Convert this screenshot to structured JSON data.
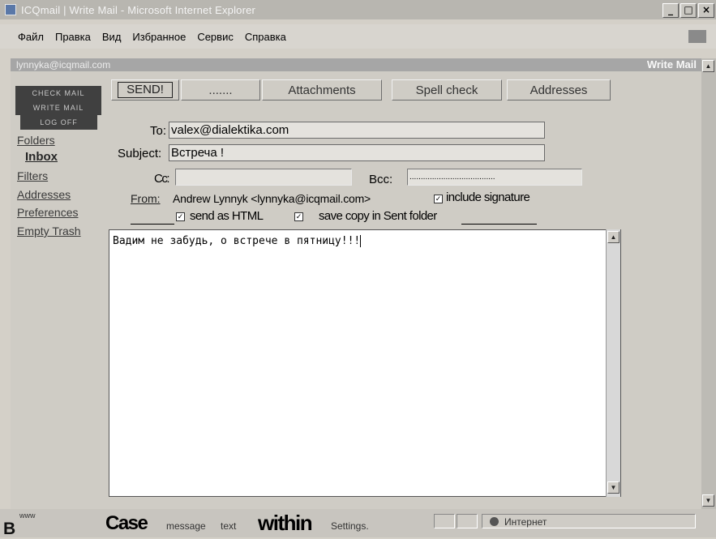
{
  "window": {
    "title": "ICQmail | Write Mail - Microsoft Internet Explorer",
    "controls": [
      "_",
      "□",
      "×"
    ]
  },
  "menu": [
    "Файл",
    "Правка",
    "Вид",
    "Избранное",
    "Сервис",
    "Справка"
  ],
  "banner": {
    "account": "lynnyka@icqmail.com",
    "page_title": "Write Mail"
  },
  "nav_buttons": [
    "Check Mail",
    "Write Mail",
    "Log Off"
  ],
  "sidebar_links": [
    "Folders",
    "Inbox",
    "Filters",
    "Addresses",
    "Preferences",
    "Empty Trash"
  ],
  "toolbar": {
    "send": "SEND!",
    "dots": ".......",
    "attachments": "Attachments",
    "spell_check": "Spell check",
    "addresses": "Addresses"
  },
  "compose": {
    "to_label": "To:",
    "to_value": "valex@dialektika.com",
    "subject_label": "Subject:",
    "subject_value": "Встреча !",
    "cc_label": "Cc:",
    "cc_value": "",
    "bcc_label": "Bcc:",
    "bcc_value": "......................................",
    "from_label": "From:",
    "from_value": "Andrew Lynnyk <lynnyka@icqmail.com>",
    "include_signature": "include signature",
    "send_as_html": "send as HTML",
    "save_copy": "save copy in Sent folder",
    "include_signature_checked": true,
    "send_as_html_checked": true,
    "save_copy_checked": true,
    "body": "Вадим не забудь, о встрече в пятницу!!!"
  },
  "status": {
    "left_letter": "В",
    "left_small": "www",
    "word1": "Case",
    "word2": "message",
    "word3": "text",
    "word4": "within",
    "word5": "Settings.",
    "zone": "Интернет"
  }
}
